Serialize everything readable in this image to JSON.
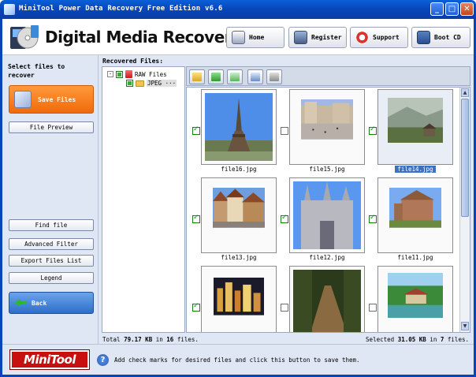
{
  "window": {
    "title": "MiniTool Power Data Recovery Free Edition v6.6",
    "minimize": "_",
    "maximize": "□",
    "close": "✕"
  },
  "header": {
    "app_heading": "Digital Media Recovery",
    "buttons": [
      {
        "label": "Home",
        "icon": "home-icon"
      },
      {
        "label": "Register",
        "icon": "register-icon"
      },
      {
        "label": "Support",
        "icon": "support-icon"
      },
      {
        "label": "Boot CD",
        "icon": "boot-cd-icon"
      }
    ]
  },
  "sidebar": {
    "title": "Select files to recover",
    "save_files": "Save Files",
    "file_preview": "File Preview",
    "find_file": "Find file",
    "advanced_filter": "Advanced Filter",
    "export_files_list": "Export Files List",
    "legend": "Legend",
    "back": "Back"
  },
  "main": {
    "recovered_files_label": "Recovered Files:",
    "tree": [
      {
        "label": "RAW Files",
        "expander": "-"
      },
      {
        "label": "JPEG ···"
      }
    ],
    "files": [
      {
        "name": "file16.jpg",
        "checked": true,
        "selected": false,
        "flag": "!"
      },
      {
        "name": "file15.jpg",
        "checked": false,
        "selected": false,
        "flag": "!"
      },
      {
        "name": "file14.jpg",
        "checked": true,
        "selected": true,
        "flag": "!"
      },
      {
        "name": "file13.jpg",
        "checked": true,
        "selected": false,
        "flag": "!"
      },
      {
        "name": "file12.jpg",
        "checked": true,
        "selected": false,
        "flag": "!"
      },
      {
        "name": "file11.jpg",
        "checked": true,
        "selected": false,
        "flag": "!"
      },
      {
        "name": "",
        "checked": true,
        "selected": false,
        "flag": "!"
      },
      {
        "name": "",
        "checked": false,
        "selected": false,
        "flag": "!"
      },
      {
        "name": "",
        "checked": false,
        "selected": false,
        "flag": "!"
      }
    ],
    "status": {
      "total_prefix": "Total",
      "total_size": "79.17 KB",
      "total_mid": "in",
      "total_count": "16",
      "total_suffix": "files.",
      "selected_prefix": "Selected",
      "selected_size": "31.05 KB",
      "selected_mid": "in",
      "selected_count": "7",
      "selected_suffix": "files."
    }
  },
  "footer": {
    "brand_text": "MiniTool",
    "help_glyph": "?",
    "hint": "Add check marks for desired files and click this button to save them."
  },
  "colors": {
    "titlebar": "#0845b8",
    "save_button": "#f06a0c",
    "back_button": "#2f6ec8",
    "panel_bg": "#dfe6f4",
    "brand_red": "#c81010"
  }
}
